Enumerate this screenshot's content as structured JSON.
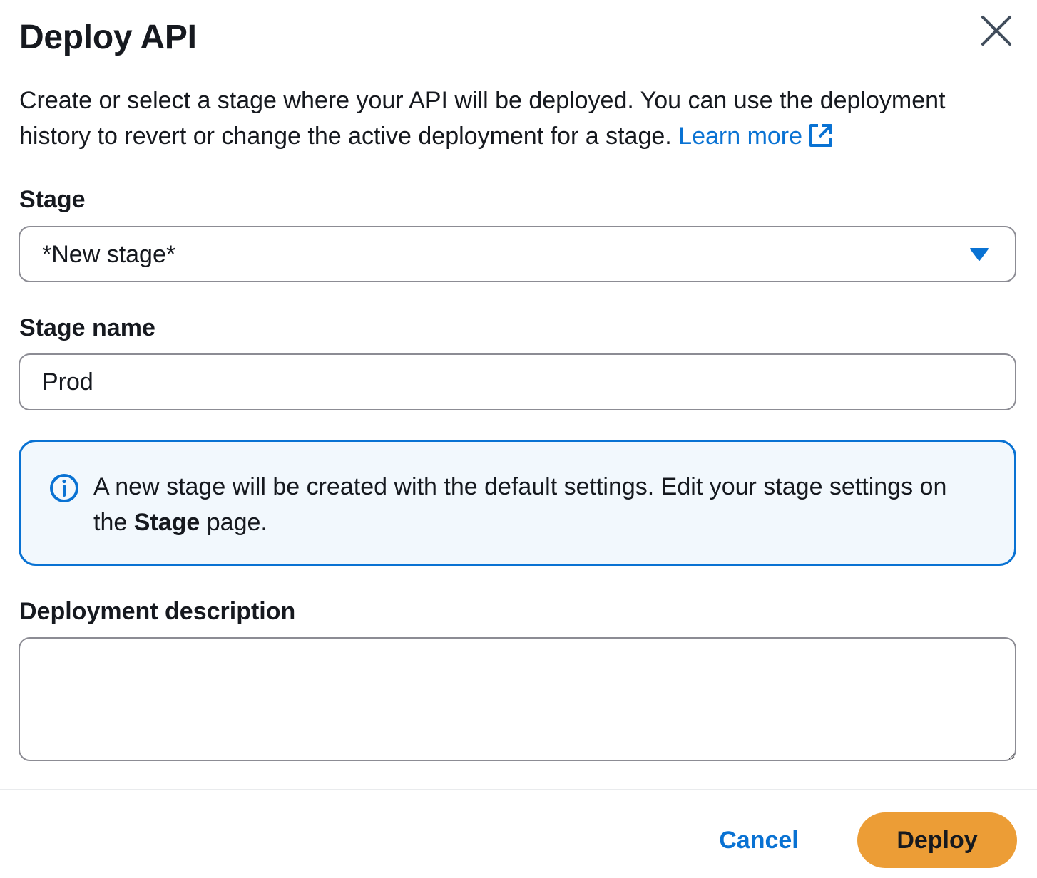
{
  "modal": {
    "title": "Deploy API",
    "description": "Create or select a stage where your API will be deployed. You can use the deployment history to revert or change the active deployment for a stage.",
    "learn_more": "Learn more"
  },
  "stage": {
    "label": "Stage",
    "selected": "*New stage*"
  },
  "stage_name": {
    "label": "Stage name",
    "value": "Prod"
  },
  "alert": {
    "text_before": "A new stage will be created with the default settings. Edit your stage settings on the ",
    "bold": "Stage",
    "text_after": " page."
  },
  "deployment_description": {
    "label": "Deployment description",
    "value": ""
  },
  "footer": {
    "cancel": "Cancel",
    "deploy": "Deploy"
  },
  "colors": {
    "link": "#0972d3",
    "primary_button": "#ec9d36",
    "alert_background": "#f2f8fd",
    "alert_border": "#0972d3"
  },
  "icons": {
    "close": "close-icon",
    "external_link": "external-link-icon",
    "dropdown": "caret-down-icon",
    "info": "info-icon"
  }
}
